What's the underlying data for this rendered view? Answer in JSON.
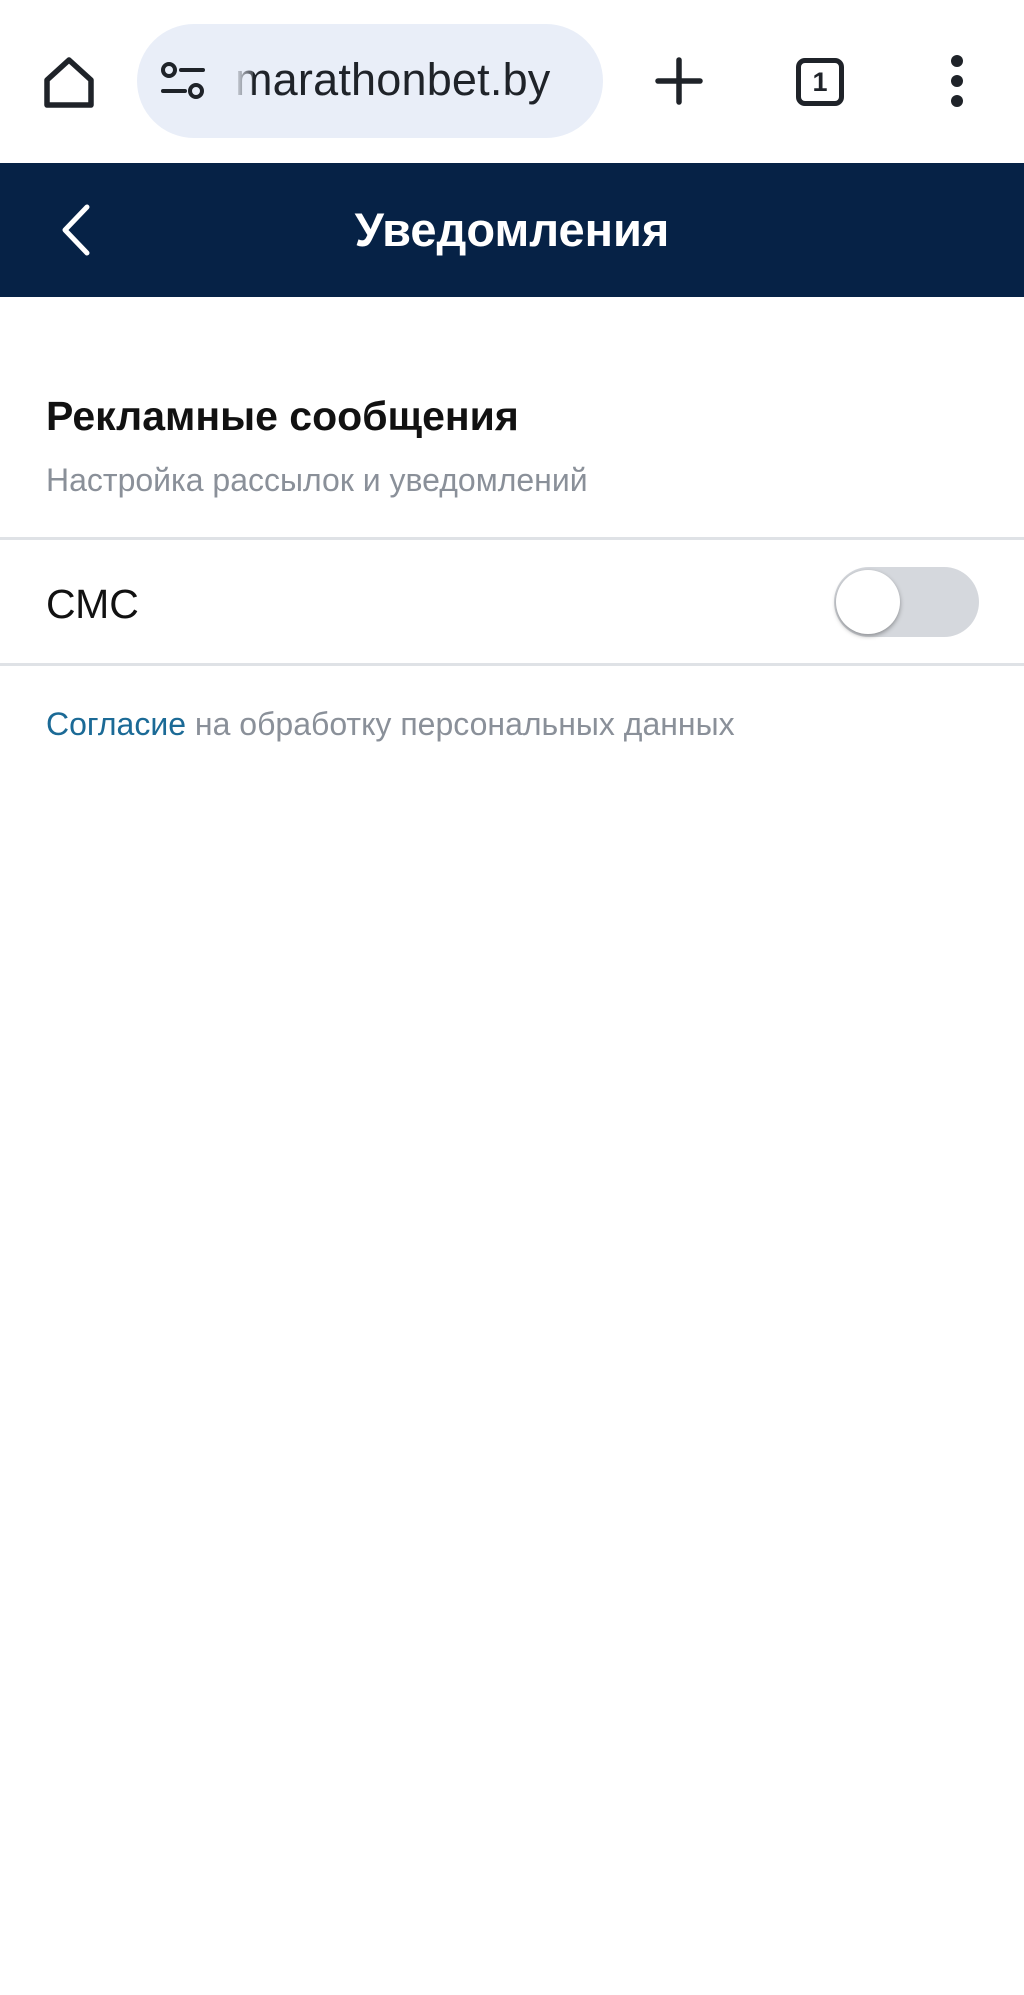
{
  "browser": {
    "url": "marathonbet.by",
    "tab_count": "1"
  },
  "header": {
    "title": "Уведомления"
  },
  "section": {
    "title": "Рекламные сообщения",
    "subtitle": "Настройка рассылок и уведомлений"
  },
  "settings": {
    "sms_label": "СМС",
    "sms_enabled": false
  },
  "consent": {
    "link_text": "Согласие",
    "rest_text": " на обработку персональных данных"
  },
  "colors": {
    "header_bg": "#062246",
    "link": "#1b6a96",
    "url_pill_bg": "#e9eef8",
    "toggle_off": "#d5d8dd"
  },
  "icons": {
    "home": "home-icon",
    "site_info": "site-settings-icon",
    "new_tab": "plus-icon",
    "tabs": "tab-switcher-icon",
    "menu": "more-vert-icon",
    "back": "chevron-left-icon"
  }
}
